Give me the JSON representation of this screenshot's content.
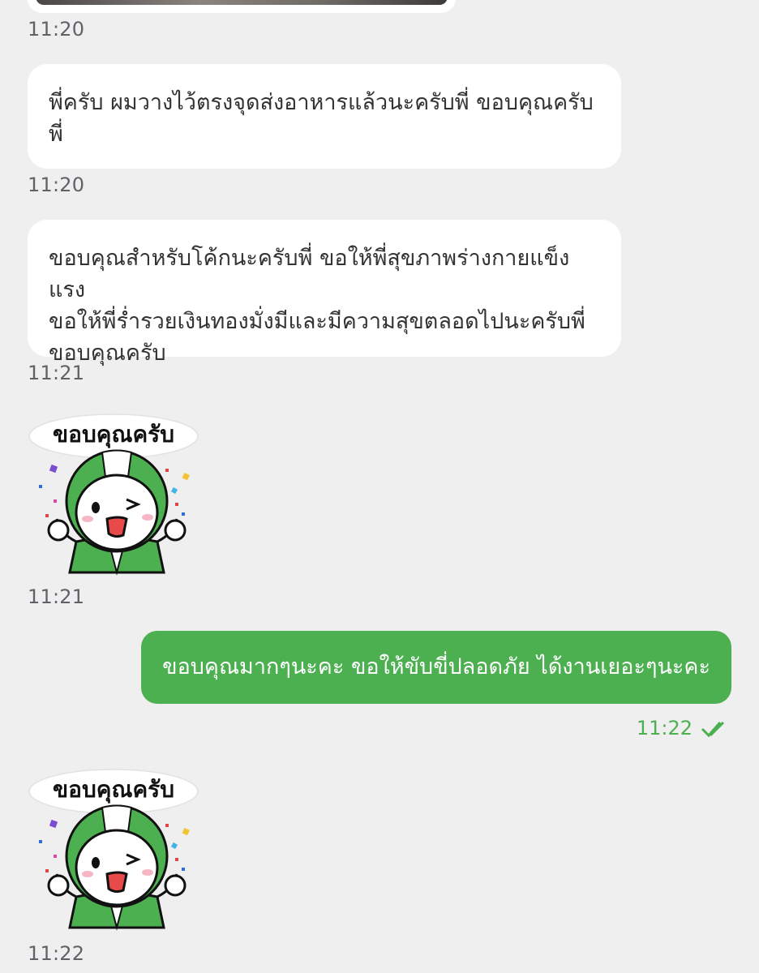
{
  "messages": [
    {
      "type": "incoming",
      "text": "พี่ครับ ผมวางไว้ตรงจุดส่งอาหารแล้วนะครับพี่ ขอบคุณครับ\nพี่",
      "time": "11:20"
    },
    {
      "type": "incoming",
      "text": "ขอบคุณสำหรับโค้กนะครับพี่ ขอให้พี่สุขภาพร่างกายแข็งแรง\nขอให้พี่ร่ำรวยเงินทองมั่งมีและมีความสุขตลอดไปนะครับพี่\nขอบคุณครับ",
      "time": "11:21"
    },
    {
      "type": "outgoing",
      "text": "ขอบคุณมากๆนะคะ ขอให้ขับขี่ปลอดภัย ได้งานเยอะๆนะคะ",
      "time": "11:22",
      "status_icon": "double-check-icon"
    }
  ],
  "top_image_time": "11:20",
  "stickers": [
    {
      "label": "ขอบคุณครับ",
      "time": "11:21",
      "icon": "thank-you-sticker-icon"
    },
    {
      "label": "ขอบคุณครับ",
      "time": "11:22",
      "icon": "thank-you-sticker-icon"
    }
  ],
  "colors": {
    "background": "#efefef",
    "incoming_bubble": "#ffffff",
    "outgoing_bubble": "#4caf50",
    "accent_green": "#4caf50",
    "timestamp_gray": "#5f6368"
  }
}
